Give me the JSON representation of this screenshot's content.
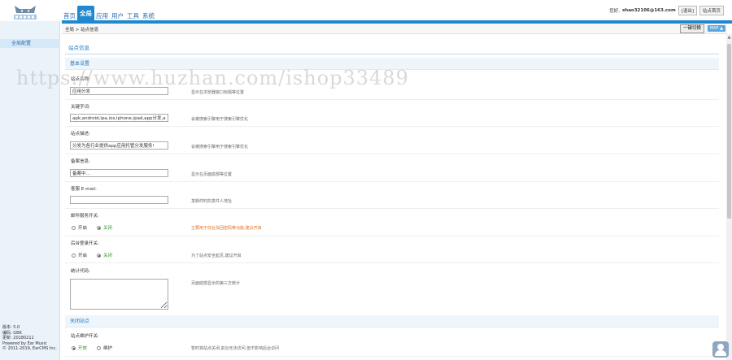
{
  "header": {
    "nav": [
      {
        "label": "首页",
        "active": false
      },
      {
        "label": "全局",
        "active": true
      },
      {
        "label": "应用",
        "active": false
      },
      {
        "label": "用户",
        "active": false
      },
      {
        "label": "工具",
        "active": false
      },
      {
        "label": "系统",
        "active": false
      }
    ],
    "user_prefix": "您好,",
    "email": "shao32106@163.com",
    "logout": "[退出]",
    "site_home": "站点首页"
  },
  "sidebar": {
    "active_item": "全局配置",
    "info": [
      "版本: 5.0",
      "编码: GBK",
      "更新: 20180211",
      "Powered by Ear Music",
      "© 2011-2019, EarCMS Inc."
    ]
  },
  "breadcrumb": {
    "text": "全局 > 站点信息",
    "switch_button": "一键切换",
    "map_button": "MAP ▲"
  },
  "main": {
    "title": "站点信息",
    "basic_section": "基本设置",
    "fields": {
      "site_name": {
        "label": "站点名称:",
        "value": "应用分发",
        "hint": "显示在浏览器窗口标题等位置"
      },
      "keywords": {
        "label": "关键字词:",
        "value": "apk,android,ipa,ios,iphone,ipad,app分发,a",
        "hint": "会被搜索引擎用于搜索引擎优化"
      },
      "description": {
        "label": "站点描述:",
        "value": "分发为各行业提供app应用托管分发服务!",
        "hint": "会被搜索引擎用于搜索引擎优化"
      },
      "icp": {
        "label": "备案信息:",
        "value": "备案中...",
        "hint": "显示在页面底部等位置"
      },
      "email": {
        "label": "客服 E-mail:",
        "value": "",
        "hint": "发邮件时的发件人地址"
      }
    },
    "mail_switch": {
      "label": "邮件服务开关:",
      "on": "开启",
      "off": "关闭",
      "hint": "主要用于前台找回密码等功能,建议开启"
    },
    "captcha_switch": {
      "label": "后台登录开关:",
      "on": "开启",
      "off": "关闭",
      "hint": "为了站点安全起见,建议开启"
    },
    "stats_code": {
      "label": "统计代码:",
      "hint": "页面底部显示的第三方统计"
    },
    "close_section": "关闭站点",
    "maintenance": {
      "label": "站点维护开关:",
      "on": "开放",
      "off": "维护",
      "hint": "暂时将站点关闭,前台无法访问,但不影响后台访问"
    }
  },
  "watermark": "https://www.huzhan.com/ishop33489"
}
